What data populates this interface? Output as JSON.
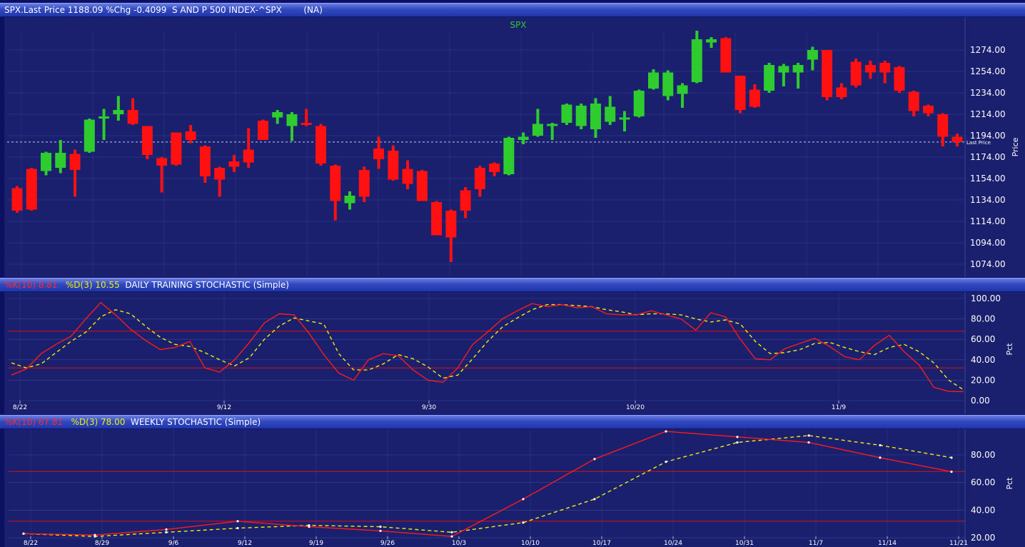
{
  "panels": {
    "price": {
      "header": {
        "text": "SPX.Last Price 1188.09 %Chg -0.4099  S AND P 500 INDEX-^SPX        (NA)"
      },
      "title": "SPX",
      "axis_label": "Price",
      "last_price_label": "Last Price",
      "y_ticks": [
        "1274.00",
        "1254.00",
        "1234.00",
        "1214.00",
        "1194.00",
        "1174.00",
        "1154.00",
        "1134.00",
        "1114.00",
        "1094.00",
        "1074.00"
      ]
    },
    "daily": {
      "header": {
        "k_label": "%K(10) 8.81",
        "d_label": "%D(3) 10.55",
        "title": "DAILY TRAINING STOCHASTIC (Simple)"
      },
      "axis_label": "Pct",
      "y_ticks": [
        "100.00",
        "80.00",
        "60.00",
        "40.00",
        "20.00",
        "0.00"
      ],
      "x_ticks": [
        "8/22",
        "9/12",
        "9/30",
        "10/20",
        "11/9"
      ]
    },
    "weekly": {
      "header": {
        "k_label": "%K(10) 67.81",
        "d_label": "%D(3) 78.00",
        "title": "WEEKLY STOCHASTIC (Simple)"
      },
      "axis_label": "Pct",
      "y_ticks": [
        "80.00",
        "60.00",
        "40.00",
        "20.00"
      ],
      "x_ticks": [
        "8/22",
        "8/29",
        "9/6",
        "9/12",
        "9/19",
        "9/26",
        "10/3",
        "10/10",
        "10/17",
        "10/24",
        "10/31",
        "11/7",
        "11/14",
        "11/21"
      ]
    }
  },
  "colors": {
    "background": "#1a1f6e",
    "up": "#2ecc2e",
    "down": "#ff1111",
    "k_line": "#ff1a1a",
    "d_line": "#f0f000",
    "grid": "#5a66b8",
    "level_line": "#dd1111"
  },
  "chart_data": [
    {
      "type": "candlestick",
      "title": "SPX",
      "ylabel": "Price",
      "ylim": [
        1070,
        1290
      ],
      "last_price": 1188.09,
      "candles": [
        {
          "o": 1145,
          "h": 1147,
          "l": 1122,
          "c": 1124
        },
        {
          "o": 1163,
          "h": 1164,
          "l": 1124,
          "c": 1125
        },
        {
          "o": 1161,
          "h": 1179,
          "l": 1157,
          "c": 1178
        },
        {
          "o": 1164,
          "h": 1190,
          "l": 1159,
          "c": 1178
        },
        {
          "o": 1177,
          "h": 1181,
          "l": 1137,
          "c": 1162
        },
        {
          "o": 1179,
          "h": 1210,
          "l": 1178,
          "c": 1209
        },
        {
          "o": 1211,
          "h": 1219,
          "l": 1190,
          "c": 1212
        },
        {
          "o": 1214,
          "h": 1231,
          "l": 1208,
          "c": 1218
        },
        {
          "o": 1218,
          "h": 1229,
          "l": 1204,
          "c": 1205
        },
        {
          "o": 1203,
          "h": 1203,
          "l": 1172,
          "c": 1176
        },
        {
          "o": 1173,
          "h": 1174,
          "l": 1141,
          "c": 1166
        },
        {
          "o": 1197,
          "h": 1197,
          "l": 1166,
          "c": 1167
        },
        {
          "o": 1198,
          "h": 1204,
          "l": 1187,
          "c": 1190
        },
        {
          "o": 1184,
          "h": 1185,
          "l": 1150,
          "c": 1156
        },
        {
          "o": 1164,
          "h": 1165,
          "l": 1137,
          "c": 1153
        },
        {
          "o": 1170,
          "h": 1176,
          "l": 1160,
          "c": 1165
        },
        {
          "o": 1181,
          "h": 1201,
          "l": 1164,
          "c": 1169
        },
        {
          "o": 1208,
          "h": 1209,
          "l": 1190,
          "c": 1190
        },
        {
          "o": 1211,
          "h": 1218,
          "l": 1205,
          "c": 1216
        },
        {
          "o": 1203,
          "h": 1216,
          "l": 1189,
          "c": 1214
        },
        {
          "o": 1206,
          "h": 1219,
          "l": 1203,
          "c": 1204
        },
        {
          "o": 1203,
          "h": 1205,
          "l": 1166,
          "c": 1168
        },
        {
          "o": 1166,
          "h": 1167,
          "l": 1115,
          "c": 1133
        },
        {
          "o": 1131,
          "h": 1142,
          "l": 1125,
          "c": 1138
        },
        {
          "o": 1162,
          "h": 1165,
          "l": 1132,
          "c": 1137
        },
        {
          "o": 1182,
          "h": 1193,
          "l": 1163,
          "c": 1172
        },
        {
          "o": 1180,
          "h": 1185,
          "l": 1152,
          "c": 1153
        },
        {
          "o": 1163,
          "h": 1171,
          "l": 1144,
          "c": 1149
        },
        {
          "o": 1161,
          "h": 1162,
          "l": 1133,
          "c": 1133
        },
        {
          "o": 1132,
          "h": 1133,
          "l": 1101,
          "c": 1101
        },
        {
          "o": 1124,
          "h": 1125,
          "l": 1076,
          "c": 1099
        },
        {
          "o": 1143,
          "h": 1146,
          "l": 1117,
          "c": 1124
        },
        {
          "o": 1164,
          "h": 1166,
          "l": 1137,
          "c": 1144
        },
        {
          "o": 1168,
          "h": 1169,
          "l": 1156,
          "c": 1160
        },
        {
          "o": 1158,
          "h": 1193,
          "l": 1157,
          "c": 1192
        },
        {
          "o": 1190,
          "h": 1197,
          "l": 1186,
          "c": 1193
        },
        {
          "o": 1194,
          "h": 1219,
          "l": 1193,
          "c": 1205
        },
        {
          "o": 1204,
          "h": 1206,
          "l": 1190,
          "c": 1205
        },
        {
          "o": 1206,
          "h": 1224,
          "l": 1204,
          "c": 1223
        },
        {
          "o": 1203,
          "h": 1224,
          "l": 1200,
          "c": 1222
        },
        {
          "o": 1200,
          "h": 1229,
          "l": 1192,
          "c": 1224
        },
        {
          "o": 1207,
          "h": 1231,
          "l": 1204,
          "c": 1221
        },
        {
          "o": 1209,
          "h": 1217,
          "l": 1198,
          "c": 1211
        },
        {
          "o": 1212,
          "h": 1237,
          "l": 1211,
          "c": 1236
        },
        {
          "o": 1238,
          "h": 1256,
          "l": 1237,
          "c": 1253
        },
        {
          "o": 1231,
          "h": 1255,
          "l": 1227,
          "c": 1253
        },
        {
          "o": 1233,
          "h": 1243,
          "l": 1220,
          "c": 1241
        },
        {
          "o": 1244,
          "h": 1292,
          "l": 1243,
          "c": 1284
        },
        {
          "o": 1281,
          "h": 1286,
          "l": 1276,
          "c": 1284
        },
        {
          "o": 1285,
          "h": 1286,
          "l": 1253,
          "c": 1253
        },
        {
          "o": 1250,
          "h": 1250,
          "l": 1215,
          "c": 1218
        },
        {
          "o": 1237,
          "h": 1242,
          "l": 1220,
          "c": 1221
        },
        {
          "o": 1236,
          "h": 1262,
          "l": 1234,
          "c": 1260
        },
        {
          "o": 1253,
          "h": 1261,
          "l": 1240,
          "c": 1259
        },
        {
          "o": 1253,
          "h": 1262,
          "l": 1238,
          "c": 1260
        },
        {
          "o": 1265,
          "h": 1277,
          "l": 1255,
          "c": 1274
        },
        {
          "o": 1274,
          "h": 1274,
          "l": 1227,
          "c": 1230
        },
        {
          "o": 1239,
          "h": 1243,
          "l": 1228,
          "c": 1230
        },
        {
          "o": 1263,
          "h": 1266,
          "l": 1239,
          "c": 1241
        },
        {
          "o": 1260,
          "h": 1264,
          "l": 1247,
          "c": 1253
        },
        {
          "o": 1262,
          "h": 1264,
          "l": 1243,
          "c": 1253
        },
        {
          "o": 1258,
          "h": 1259,
          "l": 1234,
          "c": 1236
        },
        {
          "o": 1235,
          "h": 1236,
          "l": 1212,
          "c": 1217
        },
        {
          "o": 1222,
          "h": 1223,
          "l": 1212,
          "c": 1215
        },
        {
          "o": 1214,
          "h": 1215,
          "l": 1184,
          "c": 1193
        },
        {
          "o": 1193,
          "h": 1196,
          "l": 1184,
          "c": 1188
        }
      ]
    },
    {
      "type": "line",
      "title": "DAILY TRAINING STOCHASTIC (Simple)",
      "ylabel": "Pct",
      "ylim": [
        0,
        105
      ],
      "levels": [
        68,
        32
      ],
      "x_ticks": [
        "8/22",
        "9/12",
        "9/30",
        "10/20",
        "11/9"
      ],
      "series": [
        {
          "name": "%K(10)",
          "values": [
            25,
            31,
            46,
            55,
            63,
            80,
            96,
            84,
            70,
            59,
            50,
            52,
            58,
            32,
            28,
            40,
            57,
            76,
            85,
            84,
            66,
            45,
            27,
            20,
            40,
            46,
            44,
            30,
            20,
            18,
            32,
            55,
            67,
            80,
            88,
            95,
            92,
            94,
            91,
            92,
            85,
            84,
            84,
            88,
            84,
            80,
            69,
            86,
            82,
            60,
            41,
            40,
            51,
            56,
            61,
            53,
            43,
            40,
            54,
            64,
            48,
            35,
            13,
            9,
            8.81
          ]
        },
        {
          "name": "%D(3)",
          "values": [
            37,
            32,
            36,
            47,
            58,
            67,
            82,
            89,
            85,
            73,
            62,
            55,
            53,
            47,
            40,
            34,
            42,
            60,
            73,
            81,
            78,
            75,
            46,
            30,
            30,
            36,
            45,
            41,
            33,
            22,
            25,
            41,
            58,
            72,
            81,
            89,
            94,
            94,
            93,
            92,
            89,
            87,
            84,
            85,
            85,
            84,
            80,
            77,
            79,
            75,
            58,
            46,
            47,
            50,
            56,
            57,
            52,
            48,
            45,
            52,
            55,
            48,
            37,
            20,
            10.55
          ]
        }
      ]
    },
    {
      "type": "line",
      "title": "WEEKLY STOCHASTIC (Simple)",
      "ylabel": "Pct",
      "ylim": [
        18,
        100
      ],
      "levels": [
        68,
        32
      ],
      "x": [
        "8/22",
        "8/29",
        "9/6",
        "9/12",
        "9/19",
        "9/26",
        "10/3",
        "10/10",
        "10/17",
        "10/24",
        "10/31",
        "11/7",
        "11/14",
        "11/21"
      ],
      "series": [
        {
          "name": "%K(10)",
          "values": [
            23,
            22,
            26,
            32,
            28,
            25,
            21,
            48,
            77,
            97,
            93,
            89,
            78,
            67.81
          ]
        },
        {
          "name": "%D(3)",
          "values": [
            23,
            21,
            24,
            27,
            29,
            28,
            24,
            31,
            48,
            75,
            89,
            94,
            87,
            78.0
          ]
        }
      ]
    }
  ]
}
